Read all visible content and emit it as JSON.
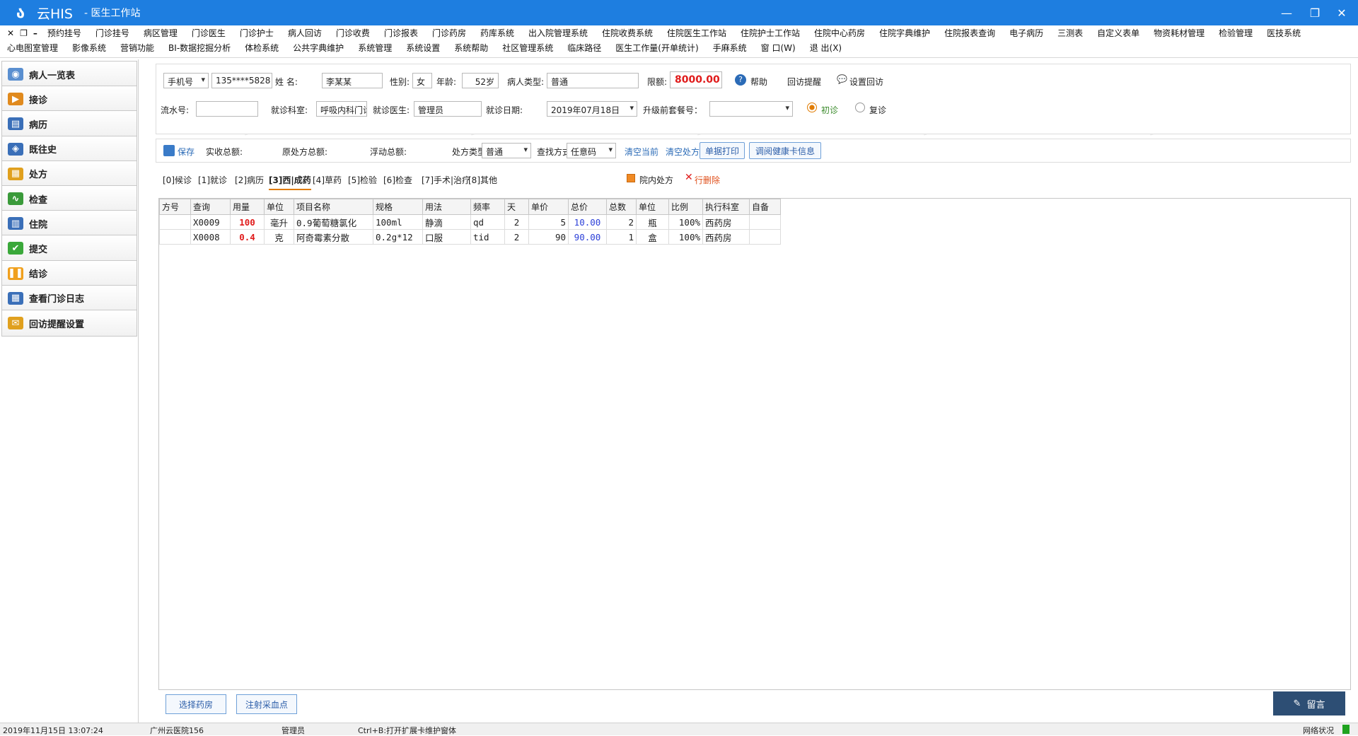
{
  "app": {
    "name": "云HIS",
    "window_title": "- 医生工作站"
  },
  "menu": {
    "row1": [
      "预约挂号",
      "门诊挂号",
      "病区管理",
      "门诊医生",
      "门诊护士",
      "病人回访",
      "门诊收费",
      "门诊报表",
      "门诊药房",
      "药库系统",
      "出入院管理系统",
      "住院收费系统",
      "住院医生工作站",
      "住院护士工作站",
      "住院中心药房",
      "住院字典维护",
      "住院报表查询",
      "电子病历",
      "三测表",
      "自定义表单",
      "物资耗材管理",
      "检验管理",
      "医技系统"
    ],
    "row2": [
      "心电图室管理",
      "影像系统",
      "营销功能",
      "BI-数据挖掘分析",
      "体检系统",
      "公共字典维护",
      "系统管理",
      "系统设置",
      "系统帮助",
      "社区管理系统",
      "临床路径",
      "医生工作量(开单统计)",
      "手麻系统",
      "窗 口(W)",
      "退 出(X)"
    ]
  },
  "sidebar": [
    "病人一览表",
    "接诊",
    "病历",
    "既往史",
    "处方",
    "检查",
    "住院",
    "提交",
    "结诊",
    "查看门诊日志",
    "回访提醒设置"
  ],
  "form": {
    "search_type": "手机号",
    "phone": "135****5828",
    "label_name": "姓    名:",
    "name": "李某某",
    "label_gender": "性别:",
    "gender": "女",
    "label_age": "年龄:",
    "age": "52岁",
    "label_ptype": "病人类型:",
    "ptype": "普通",
    "label_limit": "限额:",
    "limit": "8000.00",
    "help": "帮助",
    "followup_remind": "回访提醒",
    "followup_set": "设置回访",
    "label_serial": "流水号:",
    "serial": "",
    "label_dept": "就诊科室:",
    "dept": "呼吸内科门诊",
    "label_doctor": "就诊医生:",
    "doctor": "管理员",
    "label_date": "就诊日期:",
    "date": "2019年07月18日",
    "label_package": "升级前套餐号：",
    "package": "",
    "first_visit": "初诊",
    "return_visit": "复诊"
  },
  "toolbar": {
    "save": "保存",
    "actual_total": "实收总额:",
    "orig_total": "原处方总额:",
    "float_total": "浮动总额:",
    "label_rx_type": "处方类型",
    "rx_type": "普通",
    "label_search": "查找方式",
    "search_mode": "任意码",
    "clear_current": "清空当前",
    "clear_rx": "清空处方",
    "print": "单据打印",
    "health_card": "调阅健康卡信息"
  },
  "tabs": [
    "[0]候诊",
    "[1]就诊",
    "[2]病历",
    "[3]西|成药",
    "[4]草药",
    "[5]检验",
    "[6]检查",
    "[7]手术|治疗",
    "[8]其他"
  ],
  "tab_extras": {
    "in_hospital_rx": "院内处方",
    "delete_row": "行删除"
  },
  "grid": {
    "headers": [
      "方号",
      "查询",
      "用量",
      "单位",
      "项目名称",
      "规格",
      "用法",
      "频率",
      "天",
      "单价",
      "总价",
      "总数",
      "单位",
      "比例",
      "执行科室",
      "自备"
    ],
    "rows": [
      [
        "",
        "X0009",
        "100",
        "毫升",
        "0.9葡萄糖氯化",
        "100ml",
        "静滴",
        "qd",
        "2",
        "5",
        "10.00",
        "2",
        "瓶",
        "100%",
        "西药房",
        ""
      ],
      [
        "",
        "X0008",
        "0.4",
        "克",
        "阿奇霉素分散",
        "0.2g*12",
        "口服",
        "tid",
        "2",
        "90",
        "90.00",
        "1",
        "盒",
        "100%",
        "西药房",
        ""
      ]
    ]
  },
  "bottom": {
    "select_pharmacy": "选择药房",
    "injection_point": "注射采血点",
    "message": "留言"
  },
  "status": {
    "datetime": "2019年11月15日 13:07:24",
    "hospital": "广州云医院156",
    "user": "管理员",
    "hint": "Ctrl+B:打开扩展卡维护窗体",
    "network": "网络状况"
  }
}
